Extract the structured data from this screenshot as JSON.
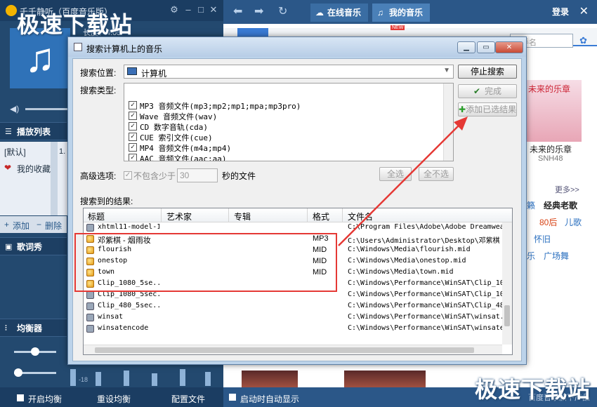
{
  "player": {
    "title": "千千静听（百度音乐版）",
    "duration_label": "长度：4:05",
    "playlist_header": "播放列表",
    "playlist_items": [
      "[默认]",
      "我的收藏"
    ],
    "playlist_song_prefix": "1.",
    "add_label": "添加",
    "delete_label": "删除",
    "lyrics_header": "歌词秀",
    "eq_header": "均衡器",
    "eq_db_label": "-18",
    "enable_eq": "开启均衡",
    "reset_eq": "重设均衡",
    "config_file": "配置文件"
  },
  "topnav": {
    "tab_online": "在线音乐",
    "tab_my": "我的音乐",
    "login": "登录"
  },
  "content": {
    "search_placeholder": "歌手名",
    "new_badge": "NEW",
    "album_title": "未来的乐章",
    "album_artist": "SNH48",
    "album_cover_text": "未来的乐章",
    "more": "更多>>",
    "tags": [
      {
        "text": "籁",
        "color": "#2a6fbf"
      },
      {
        "text": "经典老歌",
        "color": "#222222"
      },
      {
        "text": "80后",
        "color": "#d84315"
      },
      {
        "text": "儿歌",
        "color": "#2a6fbf"
      },
      {
        "text": "怀旧",
        "color": "#2a6fbf"
      },
      {
        "text": "乐",
        "color": "#2a6fbf"
      },
      {
        "text": "广场舞",
        "color": "#2a6fbf"
      }
    ],
    "autostart": "启动时自动显示",
    "baidu_note": "百度音乐旗下产品"
  },
  "dialog": {
    "title": "搜索计算机上的音乐",
    "location_label": "搜索位置:",
    "location_value": "计算机",
    "type_label": "搜索类型:",
    "types": [
      {
        "label": "MP3 音频文件(mp3;mp2;mp1;mpa;mp3pro)",
        "checked": true
      },
      {
        "label": "Wave 音频文件(wav)",
        "checked": true
      },
      {
        "label": "CD 数字音轨(cda)",
        "checked": true
      },
      {
        "label": "CUE 索引文件(cue)",
        "checked": true
      },
      {
        "label": "MP4 音频文件(m4a;mp4)",
        "checked": true
      },
      {
        "label": "AAC 音频文件(aac;aa)",
        "checked": true
      }
    ],
    "stop_search": "停止搜索",
    "done": "完成",
    "add_selected": "添加已选结果",
    "advanced_label": "高级选项:",
    "exclude_label": "不包含少于",
    "exclude_value": "30",
    "seconds_suffix": "秒的文件",
    "select_all": "全选",
    "select_none": "全不选",
    "results_label": "搜索到的结果:",
    "columns": [
      "标题",
      "艺术家",
      "专辑",
      "格式",
      "文件名"
    ],
    "rows": [
      {
        "icon": "video",
        "title": "xhtml11-model-1",
        "format": "",
        "file": "C:\\Program Files\\Adobe\\Adobe Dreamweaver"
      },
      {
        "icon": "music",
        "title": "邓紫棋 - 烟雨妆",
        "format": "MP3",
        "file": "C:\\Users\\Administrator\\Desktop\\邓紫棋 -"
      },
      {
        "icon": "music",
        "title": "flourish",
        "format": "MID",
        "file": "C:\\Windows\\Media\\flourish.mid"
      },
      {
        "icon": "music",
        "title": "onestop",
        "format": "MID",
        "file": "C:\\Windows\\Media\\onestop.mid"
      },
      {
        "icon": "music",
        "title": "town",
        "format": "MID",
        "file": "C:\\Windows\\Media\\town.mid"
      },
      {
        "icon": "music",
        "title": "Clip_1080_5se...",
        "format": "",
        "file": "C:\\Windows\\Performance\\WinSAT\\Clip_1080_"
      },
      {
        "icon": "video",
        "title": "Clip_1080_5sec...",
        "format": "",
        "file": "C:\\Windows\\Performance\\WinSAT\\Clip_1080_"
      },
      {
        "icon": "video",
        "title": "Clip_480_5sec...",
        "format": "",
        "file": "C:\\Windows\\Performance\\WinSAT\\Clip_480_5"
      },
      {
        "icon": "video",
        "title": "winsat",
        "format": "",
        "file": "C:\\Windows\\Performance\\WinSAT\\winsat.wmv"
      },
      {
        "icon": "video",
        "title": "winsatencode",
        "format": "",
        "file": "C:\\Windows\\Performance\\WinSAT\\winsatenco"
      }
    ]
  },
  "watermark": {
    "text": "极速下载站"
  },
  "colors": {
    "highlight": "#e53935",
    "accent": "#3a7bd5"
  }
}
